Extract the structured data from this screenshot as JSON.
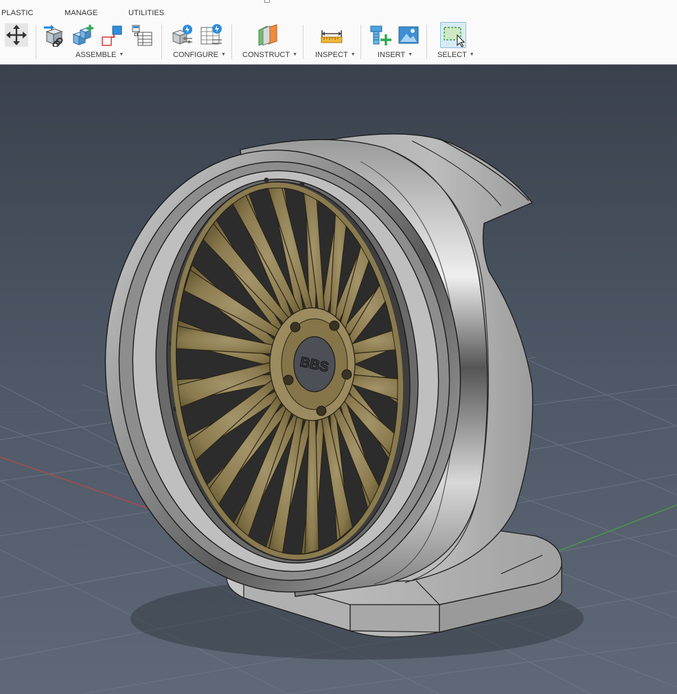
{
  "toolbar": {
    "tabs": [
      "PLASTIC",
      "MANAGE",
      "UTILITIES"
    ],
    "groups": {
      "assemble": "ASSEMBLE",
      "configure": "CONFIGURE",
      "construct": "CONSTRUCT",
      "inspect": "INSPECT",
      "insert": "INSERT",
      "select": "SELECT"
    },
    "icons": [
      "move-icon",
      "new-component-link-icon",
      "new-component-icon",
      "joint-icon",
      "table-icon",
      "configure-rule-icon",
      "configure-table-icon",
      "construct-plane-icon",
      "measure-icon",
      "insert-mcmaster-icon",
      "insert-canvas-icon",
      "select-window-icon"
    ]
  },
  "viewport": {
    "model": "wheel-display-stand",
    "center_cap_text": "BBS",
    "colors": {
      "background_top": "#3c4350",
      "background_bottom": "#5a6472",
      "spokes": "#8a7a4e",
      "rim": "#a7a7a7",
      "stand": "#b9b9b9",
      "grid": "#6b7482",
      "x_axis": "#b04a4a",
      "y_axis": "#4a9a4a"
    }
  }
}
